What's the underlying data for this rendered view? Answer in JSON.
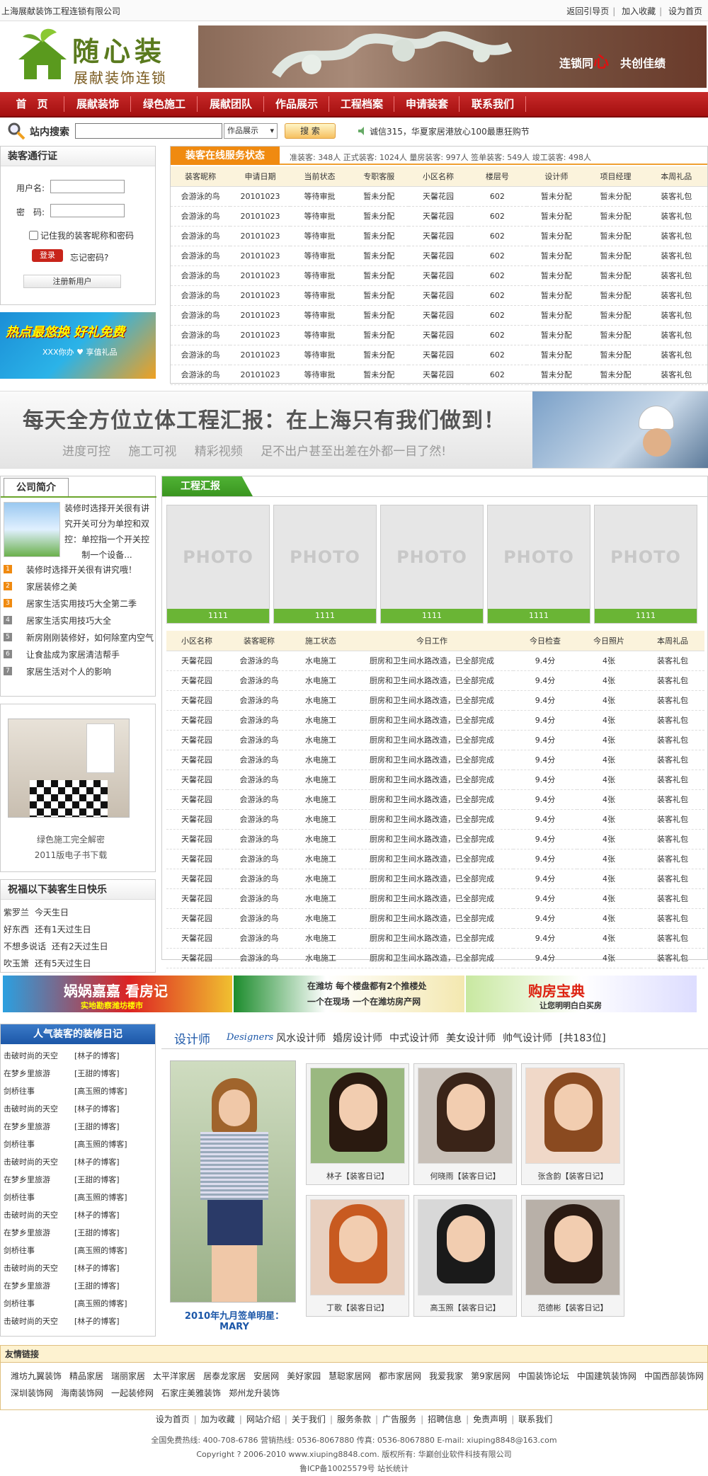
{
  "topbar": {
    "company": "上海展献装饰工程连锁有限公司",
    "links": [
      "返回引导页",
      "加入收藏",
      "设为首页"
    ]
  },
  "logo": {
    "name": "随心装",
    "sub": "展献装饰连锁"
  },
  "header_banner": {
    "text_a": "连锁同",
    "text_b": "心",
    "text_c": "共创佳绩"
  },
  "nav": [
    "首　页",
    "展献装饰",
    "绿色施工",
    "展献团队",
    "作品展示",
    "工程档案",
    "申请装套",
    "联系我们"
  ],
  "search": {
    "label": "站内搜索",
    "select": "作品展示",
    "button": "搜 索",
    "news": "诚信315，华夏家居港放心100最惠狂购节"
  },
  "login": {
    "title": "装客通行证",
    "user_label": "用户名:",
    "pwd_label": "密　码:",
    "remember": "记住我的装客昵称和密码",
    "login_btn": "登录",
    "forgot": "忘记密码?",
    "register": "注册新用户"
  },
  "ad_left": {
    "title": "热点最悠换 好礼免费",
    "sub": "XXX你办 ♥ 享值礼品"
  },
  "status": {
    "tab": "装客在线服务状态",
    "stats": "准装客: 348人  正式装客: 1024人  量房装客: 997人  签单装客: 549人  竣工装客: 498人",
    "headers": [
      "装客昵称",
      "申请日期",
      "当前状态",
      "专职客服",
      "小区名称",
      "楼层号",
      "设计师",
      "项目经理",
      "本周礼品"
    ],
    "rows": [
      [
        "会游泳的鸟",
        "20101023",
        "等待审批",
        "暂未分配",
        "天馨花园",
        "602",
        "暂未分配",
        "暂未分配",
        "装客礼包"
      ],
      [
        "会游泳的鸟",
        "20101023",
        "等待审批",
        "暂未分配",
        "天馨花园",
        "602",
        "暂未分配",
        "暂未分配",
        "装客礼包"
      ],
      [
        "会游泳的鸟",
        "20101023",
        "等待审批",
        "暂未分配",
        "天馨花园",
        "602",
        "暂未分配",
        "暂未分配",
        "装客礼包"
      ],
      [
        "会游泳的鸟",
        "20101023",
        "等待审批",
        "暂未分配",
        "天馨花园",
        "602",
        "暂未分配",
        "暂未分配",
        "装客礼包"
      ],
      [
        "会游泳的鸟",
        "20101023",
        "等待审批",
        "暂未分配",
        "天馨花园",
        "602",
        "暂未分配",
        "暂未分配",
        "装客礼包"
      ],
      [
        "会游泳的鸟",
        "20101023",
        "等待审批",
        "暂未分配",
        "天馨花园",
        "602",
        "暂未分配",
        "暂未分配",
        "装客礼包"
      ],
      [
        "会游泳的鸟",
        "20101023",
        "等待审批",
        "暂未分配",
        "天馨花园",
        "602",
        "暂未分配",
        "暂未分配",
        "装客礼包"
      ],
      [
        "会游泳的鸟",
        "20101023",
        "等待审批",
        "暂未分配",
        "天馨花园",
        "602",
        "暂未分配",
        "暂未分配",
        "装客礼包"
      ],
      [
        "会游泳的鸟",
        "20101023",
        "等待审批",
        "暂未分配",
        "天馨花园",
        "602",
        "暂未分配",
        "暂未分配",
        "装客礼包"
      ],
      [
        "会游泳的鸟",
        "20101023",
        "等待审批",
        "暂未分配",
        "天馨花园",
        "602",
        "暂未分配",
        "暂未分配",
        "装客礼包"
      ]
    ]
  },
  "big_banner": {
    "headline": "每天全方位立体工程汇报：在上海只有我们做到！",
    "sub": "进度可控 施工可视 精彩视频 足不出户甚至出差在外都一目了然!"
  },
  "company": {
    "tab": "公司简介",
    "desc": "装修时选择开关很有讲究开关可分为单控和双控：单控指一个开关控制一个设备...",
    "items": [
      {
        "n": "1",
        "t": "装修时选择开关很有讲究哦！"
      },
      {
        "n": "2",
        "t": "家居装修之美"
      },
      {
        "n": "3",
        "t": "居家生活实用技巧大全第二季"
      },
      {
        "n": "4",
        "t": "居家生活实用技巧大全"
      },
      {
        "n": "5",
        "t": "新房刚刚装修好，如何除室内空气"
      },
      {
        "n": "6",
        "t": "让食盐成为家居清洁帮手"
      },
      {
        "n": "7",
        "t": "家居生活对个人的影响"
      }
    ]
  },
  "green": {
    "c1": "绿色施工完全解密",
    "c2": "2011版电子书下载"
  },
  "birthday": {
    "title": "祝福以下装客生日快乐",
    "items": [
      [
        "紫罗兰",
        "今天生日"
      ],
      [
        "好东西",
        "还有1天过生日"
      ],
      [
        "不想多说话",
        "还有2天过生日"
      ],
      [
        "吹玉箫",
        "还有5天过生日"
      ]
    ]
  },
  "progress": {
    "tab": "工程汇报",
    "photos": [
      "1111",
      "1111",
      "1111",
      "1111",
      "1111"
    ],
    "photo_placeholder": "PHOTO",
    "headers": [
      "小区名称",
      "装客昵称",
      "施工状态",
      "今日工作",
      "今日检查",
      "今日照片",
      "本周礼品"
    ],
    "rows": [
      [
        "天馨花园",
        "会游泳的鸟",
        "水电施工",
        "厨房和卫生间水路改造，已全部完成",
        "9.4分",
        "4张",
        "装客礼包"
      ],
      [
        "天馨花园",
        "会游泳的鸟",
        "水电施工",
        "厨房和卫生间水路改造，已全部完成",
        "9.4分",
        "4张",
        "装客礼包"
      ],
      [
        "天馨花园",
        "会游泳的鸟",
        "水电施工",
        "厨房和卫生间水路改造，已全部完成",
        "9.4分",
        "4张",
        "装客礼包"
      ],
      [
        "天馨花园",
        "会游泳的鸟",
        "水电施工",
        "厨房和卫生间水路改造，已全部完成",
        "9.4分",
        "4张",
        "装客礼包"
      ],
      [
        "天馨花园",
        "会游泳的鸟",
        "水电施工",
        "厨房和卫生间水路改造，已全部完成",
        "9.4分",
        "4张",
        "装客礼包"
      ],
      [
        "天馨花园",
        "会游泳的鸟",
        "水电施工",
        "厨房和卫生间水路改造，已全部完成",
        "9.4分",
        "4张",
        "装客礼包"
      ],
      [
        "天馨花园",
        "会游泳的鸟",
        "水电施工",
        "厨房和卫生间水路改造，已全部完成",
        "9.4分",
        "4张",
        "装客礼包"
      ],
      [
        "天馨花园",
        "会游泳的鸟",
        "水电施工",
        "厨房和卫生间水路改造，已全部完成",
        "9.4分",
        "4张",
        "装客礼包"
      ],
      [
        "天馨花园",
        "会游泳的鸟",
        "水电施工",
        "厨房和卫生间水路改造，已全部完成",
        "9.4分",
        "4张",
        "装客礼包"
      ],
      [
        "天馨花园",
        "会游泳的鸟",
        "水电施工",
        "厨房和卫生间水路改造，已全部完成",
        "9.4分",
        "4张",
        "装客礼包"
      ],
      [
        "天馨花园",
        "会游泳的鸟",
        "水电施工",
        "厨房和卫生间水路改造，已全部完成",
        "9.4分",
        "4张",
        "装客礼包"
      ],
      [
        "天馨花园",
        "会游泳的鸟",
        "水电施工",
        "厨房和卫生间水路改造，已全部完成",
        "9.4分",
        "4张",
        "装客礼包"
      ],
      [
        "天馨花园",
        "会游泳的鸟",
        "水电施工",
        "厨房和卫生间水路改造，已全部完成",
        "9.4分",
        "4张",
        "装客礼包"
      ],
      [
        "天馨花园",
        "会游泳的鸟",
        "水电施工",
        "厨房和卫生间水路改造，已全部完成",
        "9.4分",
        "4张",
        "装客礼包"
      ],
      [
        "天馨花园",
        "会游泳的鸟",
        "水电施工",
        "厨房和卫生间水路改造，已全部完成",
        "9.4分",
        "4张",
        "装客礼包"
      ],
      [
        "天馨花园",
        "会游泳的鸟",
        "水电施工",
        "厨房和卫生间水路改造，已全部完成",
        "9.4分",
        "4张",
        "装客礼包"
      ]
    ]
  },
  "ads": {
    "a1": "娲娲嘉嘉 看房记",
    "a1s": "实地勘察潍坊楼市",
    "a2": "在潍坊 每个楼盘都有2个推楼处",
    "a2s": "一个在现场 一个在潍坊房产网",
    "a3": "购房宝典",
    "a3s": "让您明明白白买房"
  },
  "diary": {
    "title": "人气装客的装修日记",
    "rows": [
      [
        "击破时尚的天空",
        "[林子的博客]"
      ],
      [
        "在梦乡里旅游",
        "[王甜的博客]"
      ],
      [
        "剑桥往事",
        "[高玉照的博客]"
      ],
      [
        "击破时尚的天空",
        "[林子的博客]"
      ],
      [
        "在梦乡里旅游",
        "[王甜的博客]"
      ],
      [
        "剑桥往事",
        "[高玉照的博客]"
      ],
      [
        "击破时尚的天空",
        "[林子的博客]"
      ],
      [
        "在梦乡里旅游",
        "[王甜的博客]"
      ],
      [
        "剑桥往事",
        "[高玉照的博客]"
      ],
      [
        "击破时尚的天空",
        "[林子的博客]"
      ],
      [
        "在梦乡里旅游",
        "[王甜的博客]"
      ],
      [
        "剑桥往事",
        "[高玉照的博客]"
      ],
      [
        "击破时尚的天空",
        "[林子的博客]"
      ],
      [
        "在梦乡里旅游",
        "[王甜的博客]"
      ],
      [
        "剑桥往事",
        "[高玉照的博客]"
      ],
      [
        "击破时尚的天空",
        "[林子的博客]"
      ]
    ]
  },
  "designers": {
    "title": "设计师",
    "title_en": "Designers",
    "cats": [
      "风水设计师",
      "婚房设计师",
      "中式设计师",
      "美女设计师",
      "帅气设计师",
      "[共183位]"
    ],
    "star": "2010年九月签单明星：MARY",
    "cards": [
      "林子【装客日记】",
      "何晓雨【装客日记】",
      "张含韵【装客日记】",
      "丁歌【装客日记】",
      "高玉照【装客日记】",
      "范德彬【装客日记】"
    ]
  },
  "links": {
    "title": "友情链接",
    "row1": [
      "潍坊九翼装饰",
      "精品家居",
      "瑞丽家居",
      "太平洋家居",
      "居泰龙家居",
      "安居网",
      "美好家园",
      "慧聪家居网",
      "都市家居网",
      "我爱我家",
      "第9家居网",
      "中国装饰论坛",
      "中国建筑装饰网",
      "中国西部装饰网"
    ],
    "row2": [
      "深圳装饰网",
      "海南装饰网",
      "一起装修网",
      "石家庄美雅装饰",
      "郑州龙升装饰"
    ]
  },
  "footer": {
    "links": [
      "设为首页",
      "加为收藏",
      "网站介绍",
      "关于我们",
      "服务条款",
      "广告服务",
      "招聘信息",
      "免责声明",
      "联系我们"
    ],
    "line2": "全国免费热线: 400-708-6786 营销热线: 0536-8067880 传真: 0536-8067880 E-mail: xiuping8848@163.com",
    "line3": "Copyright ? 2006-2010 www.xiuping8848.com. 版权所有: 华巅创业软件科技有限公司",
    "line4": "鲁ICP备10025579号 站长统计"
  }
}
